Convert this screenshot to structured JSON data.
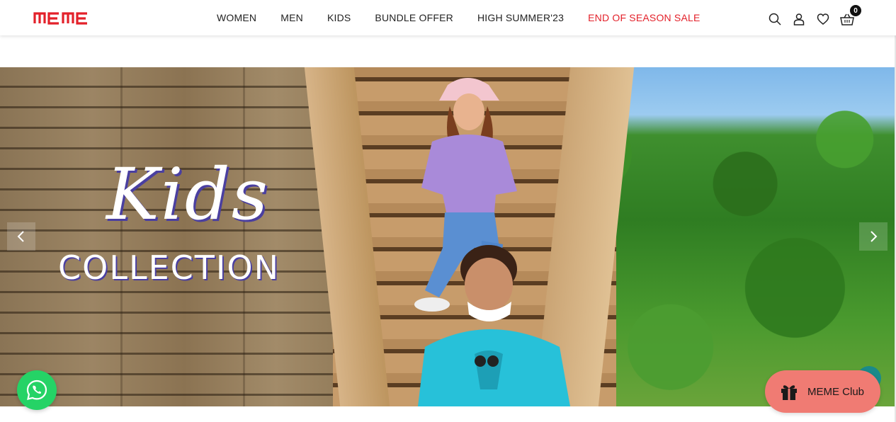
{
  "header": {
    "logo_text": "MEME",
    "nav": [
      {
        "label": "WOMEN"
      },
      {
        "label": "MEN"
      },
      {
        "label": "KIDS"
      },
      {
        "label": "BUNDLE OFFER"
      },
      {
        "label": "HIGH SUMMER'23"
      },
      {
        "label": "END OF SEASON SALE"
      }
    ],
    "icons": [
      "search-icon",
      "user-icon",
      "heart-icon",
      "basket-icon"
    ],
    "cart_count": "0"
  },
  "hero": {
    "title_script": "Kids",
    "title_caps": "COLLECTION"
  },
  "widgets": {
    "whatsapp_icon": "whatsapp-icon",
    "club_label": "MEME Club",
    "club_icon": "gift-icon"
  },
  "colors": {
    "brand_red": "#e3212a",
    "whatsapp_green": "#25d366",
    "club_coral": "#f07b73"
  }
}
